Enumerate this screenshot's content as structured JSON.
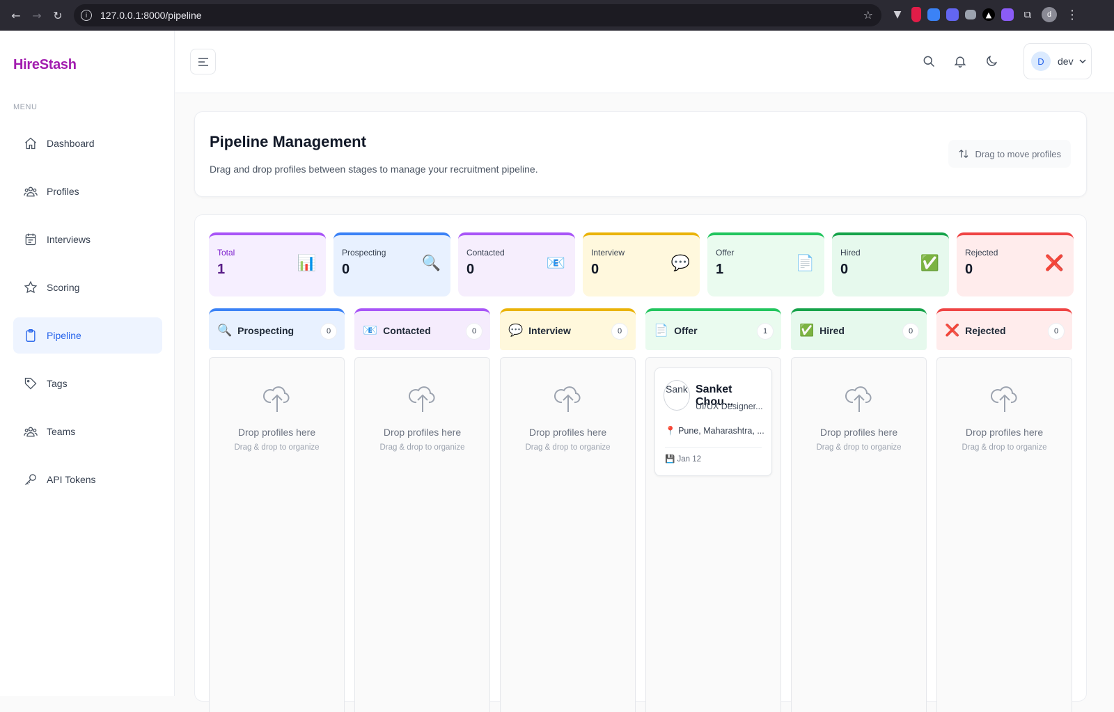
{
  "browser": {
    "url": "127.0.0.1:8000/pipeline",
    "profile_initial": "d"
  },
  "sidebar": {
    "brand": "HireStash",
    "menu_label": "MENU",
    "items": [
      {
        "label": "Dashboard",
        "icon": "home-icon"
      },
      {
        "label": "Profiles",
        "icon": "users-icon"
      },
      {
        "label": "Interviews",
        "icon": "calendar-icon"
      },
      {
        "label": "Scoring",
        "icon": "star-icon"
      },
      {
        "label": "Pipeline",
        "icon": "clipboard-icon",
        "active": true
      },
      {
        "label": "Tags",
        "icon": "tag-icon"
      },
      {
        "label": "Teams",
        "icon": "users-icon"
      },
      {
        "label": "API Tokens",
        "icon": "key-icon"
      }
    ]
  },
  "topbar": {
    "user_initial": "D",
    "user_name": "dev"
  },
  "header": {
    "title": "Pipeline Management",
    "subtitle": "Drag and drop profiles between stages to manage your recruitment pipeline.",
    "drag_hint": "Drag to move profiles"
  },
  "stats": [
    {
      "label": "Total",
      "value": "1",
      "emoji": "📊",
      "color": "#a855f7",
      "bg": "#f6efff"
    },
    {
      "label": "Prospecting",
      "value": "0",
      "emoji": "🔍",
      "color": "#3b82f6",
      "bg": "#e8f1ff"
    },
    {
      "label": "Contacted",
      "value": "0",
      "emoji": "📧",
      "color": "#a855f7",
      "bg": "#f6eefd"
    },
    {
      "label": "Interview",
      "value": "0",
      "emoji": "💬",
      "color": "#eab308",
      "bg": "#fff8dd"
    },
    {
      "label": "Offer",
      "value": "1",
      "emoji": "📄",
      "color": "#22c55e",
      "bg": "#eafbef"
    },
    {
      "label": "Hired",
      "value": "0",
      "emoji": "✅",
      "color": "#16a34a",
      "bg": "#e6f9ed"
    },
    {
      "label": "Rejected",
      "value": "0",
      "emoji": "❌",
      "color": "#ef4444",
      "bg": "#ffecec"
    }
  ],
  "columns": [
    {
      "name": "Prospecting",
      "count": "0",
      "emoji": "🔍",
      "color": "#3b82f6",
      "bg": "#e8f1ff"
    },
    {
      "name": "Contacted",
      "count": "0",
      "emoji": "📧",
      "color": "#a855f7",
      "bg": "#f5ecfd"
    },
    {
      "name": "Interview",
      "count": "0",
      "emoji": "💬",
      "color": "#eab308",
      "bg": "#fff8dc"
    },
    {
      "name": "Offer",
      "count": "1",
      "emoji": "📄",
      "color": "#22c55e",
      "bg": "#eafbef"
    },
    {
      "name": "Hired",
      "count": "0",
      "emoji": "✅",
      "color": "#16a34a",
      "bg": "#e6f9ed"
    },
    {
      "name": "Rejected",
      "count": "0",
      "emoji": "❌",
      "color": "#ef4444",
      "bg": "#ffecec"
    }
  ],
  "empty_state": {
    "title": "Drop profiles here",
    "subtitle": "Drag & drop to organize"
  },
  "offer_card": {
    "photo_alt": "Sank",
    "name": "Sanket Chou...",
    "role": "UI/UX Designer...",
    "location": "Pune, Maharashtra, ...",
    "date": "Jan 12"
  }
}
